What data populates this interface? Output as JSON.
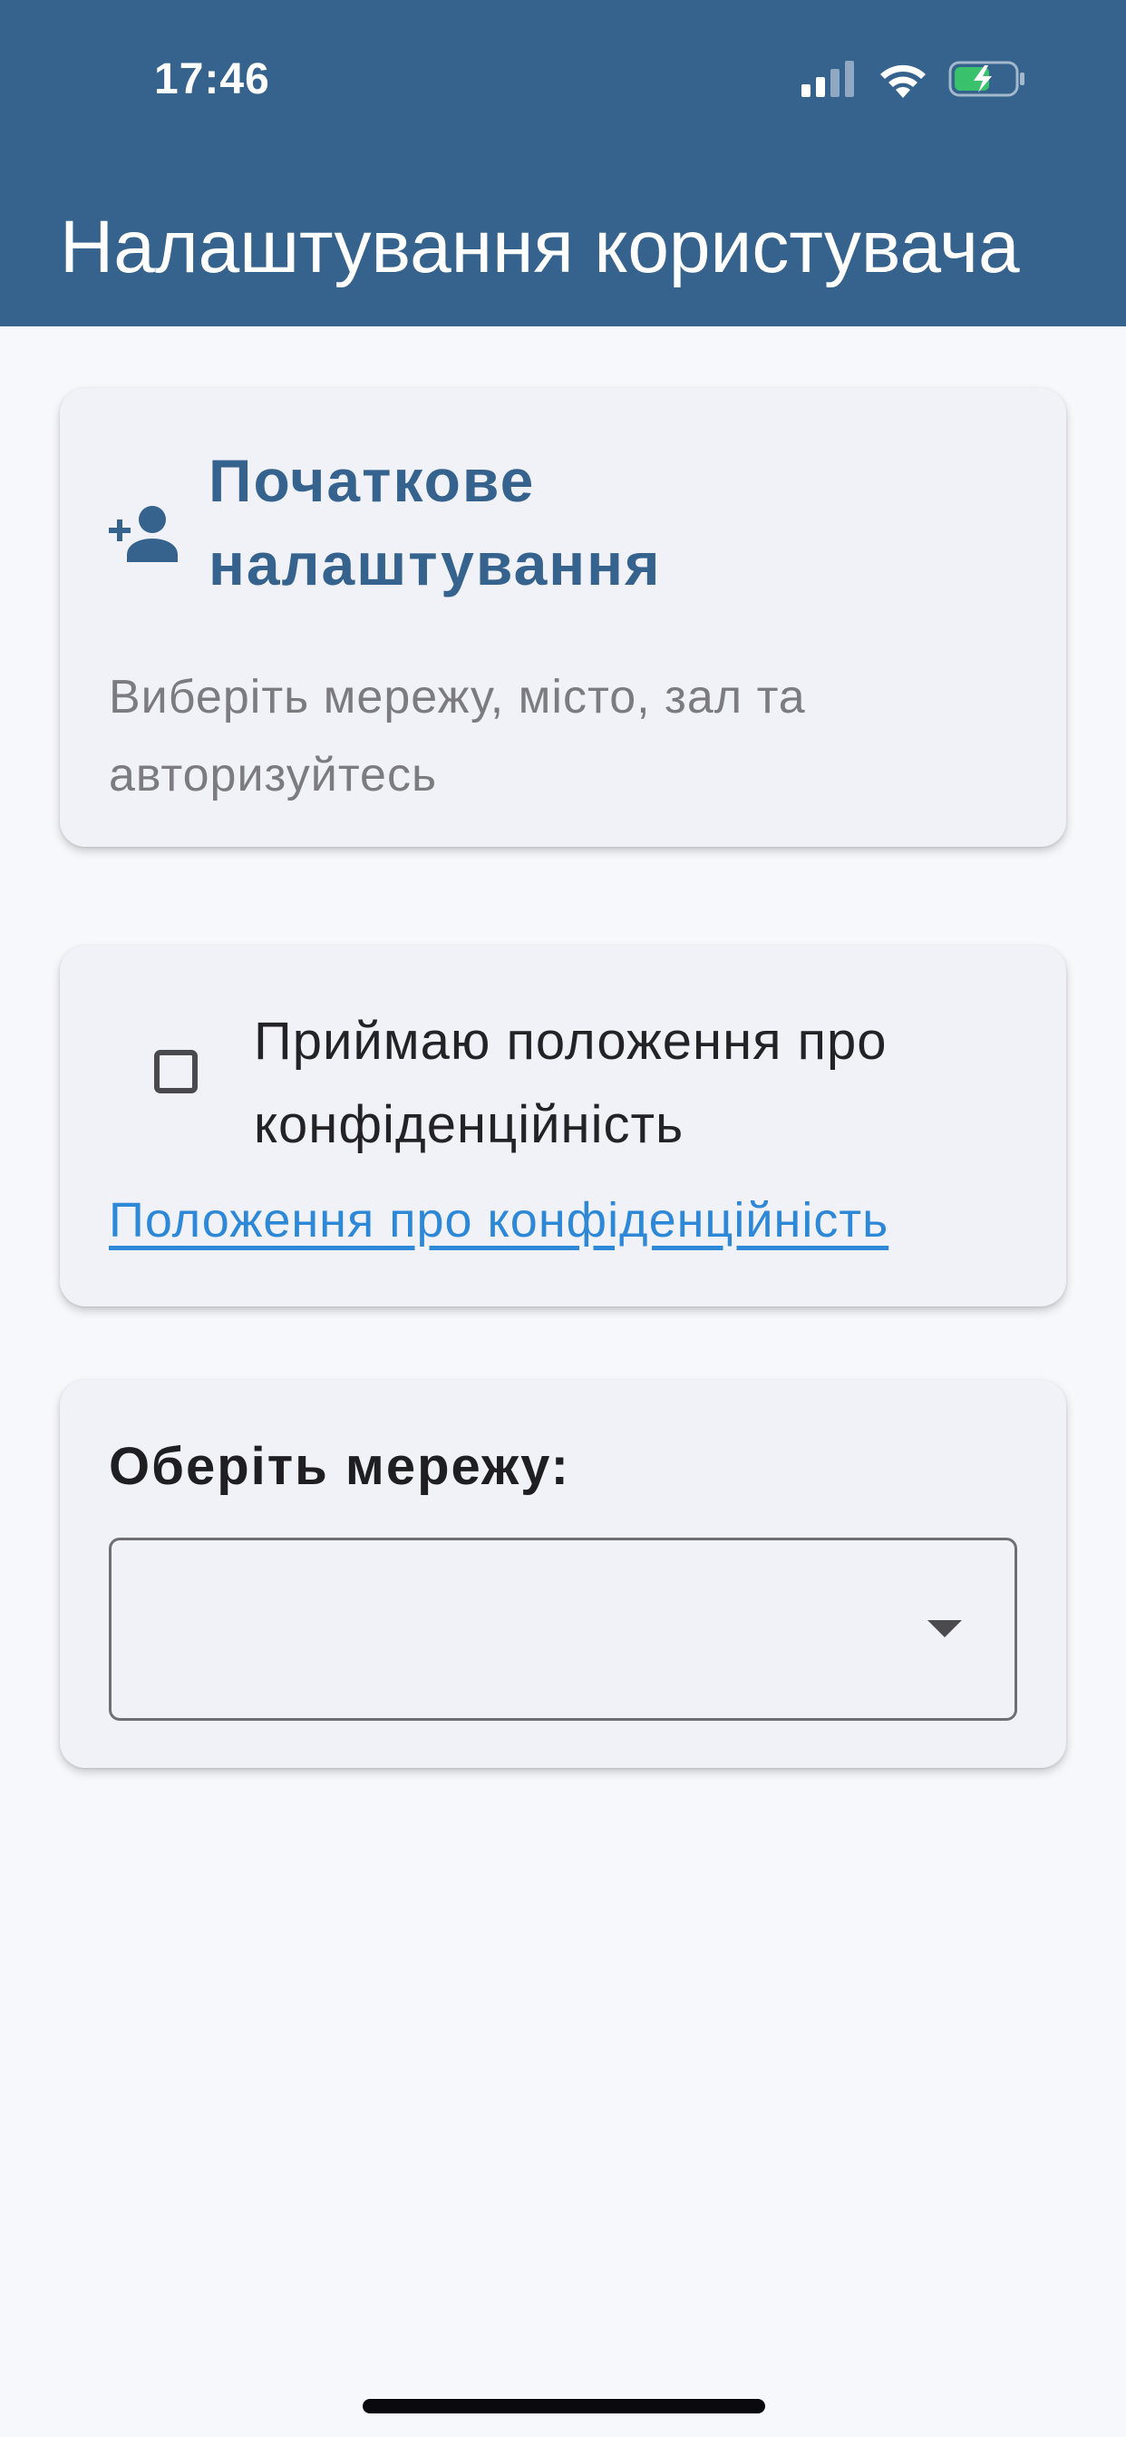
{
  "status_bar": {
    "time": "17:46",
    "icons": [
      "signal-icon",
      "wifi-icon",
      "battery-charging-icon"
    ],
    "battery_color": "#39c16c"
  },
  "app_bar": {
    "title": "Налаштування користувача",
    "background": "#36628e"
  },
  "setup_card": {
    "icon": "person-add-icon",
    "title": "Початкове налаштування",
    "subtitle": "Виберіть мережу, місто, зал та авторизуйтесь"
  },
  "privacy_card": {
    "checkbox_checked": false,
    "checkbox_label": "Приймаю положення про конфіденційність",
    "link_text": "Положення про конфіденційність",
    "link_color": "#2e88d8"
  },
  "network_card": {
    "label": "Оберіть мережу:",
    "selected_value": "",
    "dropdown_icon": "arrow-drop-down-icon"
  }
}
